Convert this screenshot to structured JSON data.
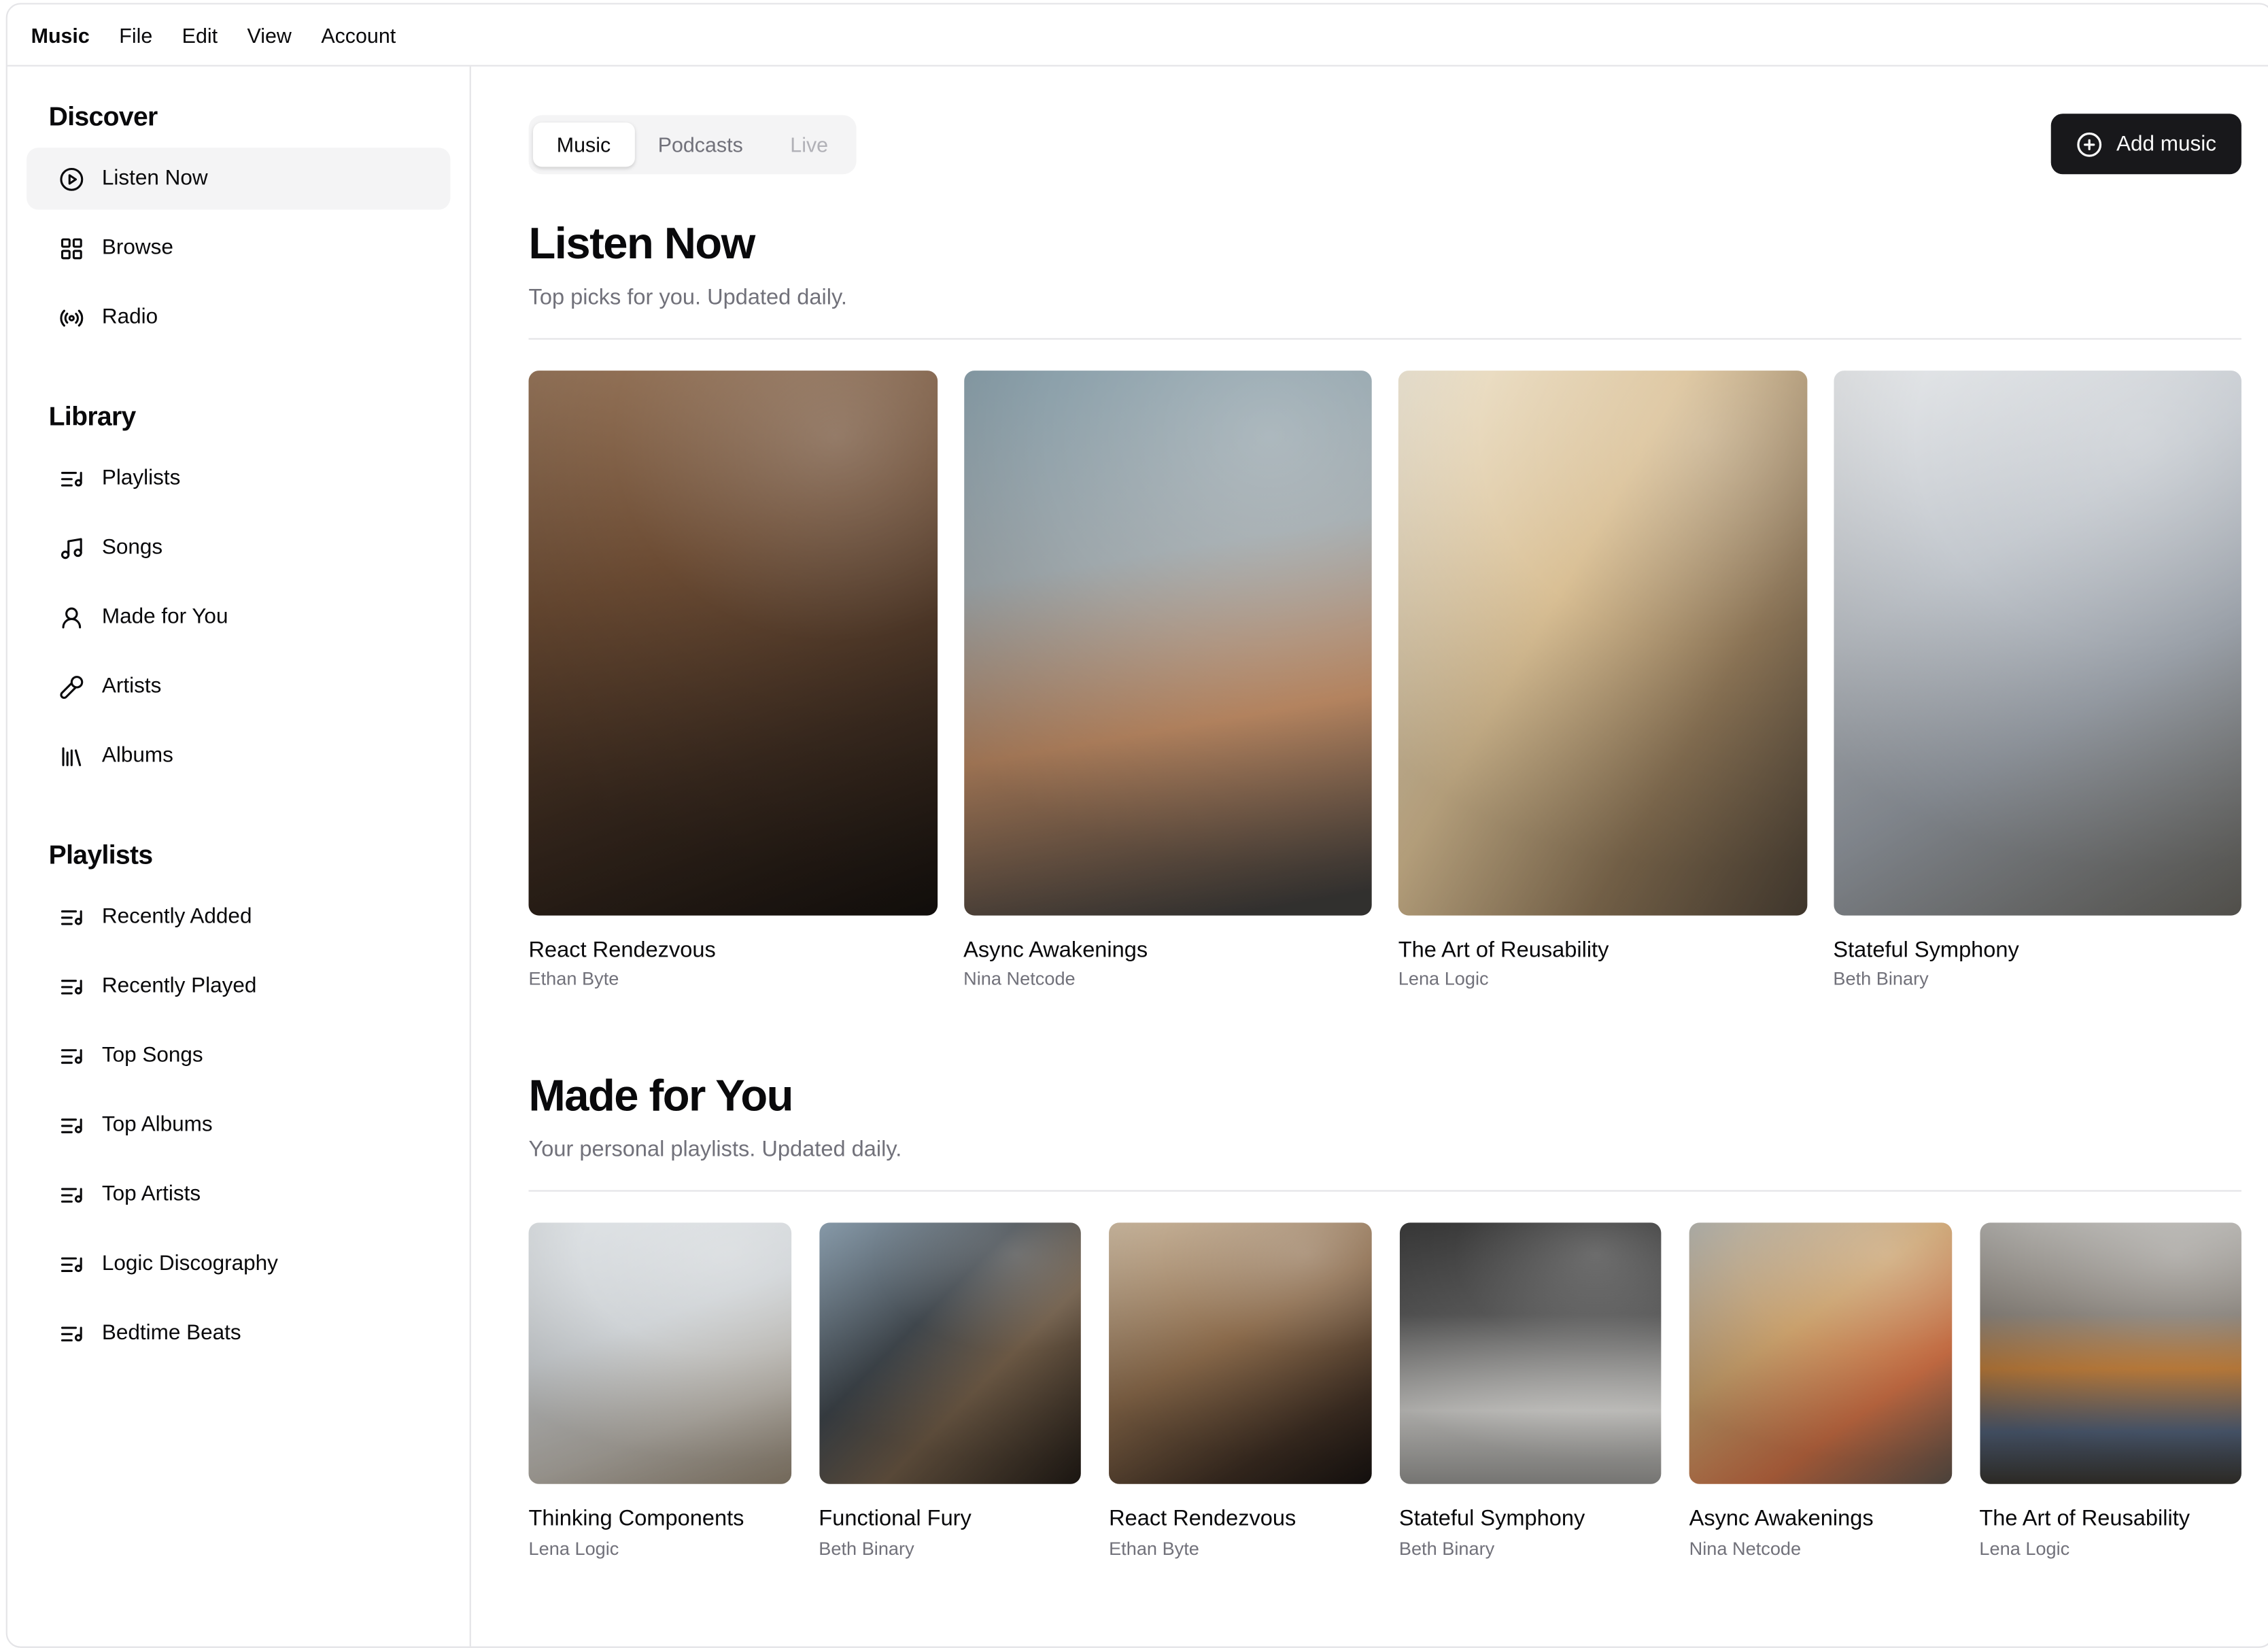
{
  "menubar": {
    "items": [
      {
        "label": "Music",
        "active": true
      },
      {
        "label": "File"
      },
      {
        "label": "Edit"
      },
      {
        "label": "View"
      },
      {
        "label": "Account"
      }
    ]
  },
  "sidebar": {
    "sections": [
      {
        "heading": "Discover",
        "items": [
          {
            "label": "Listen Now",
            "icon": "circle-play",
            "active": true
          },
          {
            "label": "Browse",
            "icon": "layout-grid"
          },
          {
            "label": "Radio",
            "icon": "radio"
          }
        ]
      },
      {
        "heading": "Library",
        "items": [
          {
            "label": "Playlists",
            "icon": "list-music"
          },
          {
            "label": "Songs",
            "icon": "music-note"
          },
          {
            "label": "Made for You",
            "icon": "user-round"
          },
          {
            "label": "Artists",
            "icon": "microphone"
          },
          {
            "label": "Albums",
            "icon": "library"
          }
        ]
      },
      {
        "heading": "Playlists",
        "items": [
          {
            "label": "Recently Added",
            "icon": "list-music"
          },
          {
            "label": "Recently Played",
            "icon": "list-music"
          },
          {
            "label": "Top Songs",
            "icon": "list-music"
          },
          {
            "label": "Top Albums",
            "icon": "list-music"
          },
          {
            "label": "Top Artists",
            "icon": "list-music"
          },
          {
            "label": "Logic Discography",
            "icon": "list-music"
          },
          {
            "label": "Bedtime Beats",
            "icon": "list-music"
          }
        ]
      }
    ]
  },
  "main": {
    "tabs": [
      {
        "label": "Music",
        "state": "active"
      },
      {
        "label": "Podcasts",
        "state": "default"
      },
      {
        "label": "Live",
        "state": "disabled"
      }
    ],
    "add_button": {
      "label": "Add music",
      "icon": "circle-plus"
    },
    "sections": [
      {
        "title": "Listen Now",
        "subtitle": "Top picks for you. Updated daily.",
        "cards": [
          {
            "title": "React Rendezvous",
            "artist": "Ethan Byte",
            "gradient": {
              "angle": "160deg",
              "stops": [
                "#96755a",
                "#6b4b33 35%",
                "#3a2a1f 68%",
                "#14100d"
              ]
            }
          },
          {
            "title": "Async Awakenings",
            "artist": "Nina Netcode",
            "gradient": {
              "angle": "170deg",
              "stops": [
                "#8aa0ab",
                "#9fa8ac 35%",
                "#bd8a64 64%",
                "#3c3a38 96%"
              ]
            }
          },
          {
            "title": "The Art of Reusability",
            "artist": "Lena Logic",
            "gradient": {
              "angle": "120deg",
              "stops": [
                "#f2ead8",
                "#d9bf94 40%",
                "#8a7355 70%",
                "#4c4135"
              ]
            }
          },
          {
            "title": "Stateful Symphony",
            "artist": "Beth Binary",
            "gradient": {
              "angle": "150deg",
              "stops": [
                "#e8eaec",
                "#c2c7cd 35%",
                "#9aa0a8 62%",
                "#62605a"
              ]
            }
          }
        ]
      },
      {
        "title": "Made for You",
        "subtitle": "Your personal playlists. Updated daily.",
        "cards": [
          {
            "title": "Thinking Components",
            "artist": "Lena Logic",
            "gradient": {
              "angle": "160deg",
              "stops": [
                "#dfe3e6",
                "#cfd3d6 40%",
                "#b5b0a8 72%",
                "#8c7f6d"
              ]
            }
          },
          {
            "title": "Functional Fury",
            "artist": "Beth Binary",
            "gradient": {
              "angle": "135deg",
              "stops": [
                "#8fa3b3",
                "#3f464c 38%",
                "#6b5844 62%",
                "#201a15"
              ]
            }
          },
          {
            "title": "React Rendezvous",
            "artist": "Ethan Byte",
            "gradient": {
              "angle": "150deg",
              "stops": [
                "#cdbaa1",
                "#8a6a4b 45%",
                "#3c2d22 78%",
                "#171210"
              ]
            }
          },
          {
            "title": "Stateful Symphony",
            "artist": "Beth Binary",
            "gradient": {
              "angle": "180deg",
              "stops": [
                "#3a3a3a",
                "#555555 35%",
                "#cfcecb 72%",
                "#8f8e8b"
              ]
            }
          },
          {
            "title": "Async Awakenings",
            "artist": "Nina Netcode",
            "gradient": {
              "angle": "145deg",
              "stops": [
                "#b4b4ae",
                "#c9a06c 40%",
                "#c26a42 70%",
                "#5a5048"
              ]
            }
          },
          {
            "title": "The Art of Reusability",
            "artist": "Lena Logic",
            "gradient": {
              "angle": "180deg",
              "stops": [
                "#aeaca8",
                "#87817a 35%",
                "#b97a3a 56%",
                "#4e5d74 80%",
                "#35322c"
              ]
            }
          }
        ]
      }
    ]
  },
  "colors": {
    "text": "#09090b",
    "muted_text": "#71717a",
    "border": "#e4e4e7",
    "active_item_bg": "#f4f4f5",
    "tabs_bg": "#f4f4f5",
    "primary_button_bg": "#18181b",
    "primary_button_text": "#fafafa"
  }
}
